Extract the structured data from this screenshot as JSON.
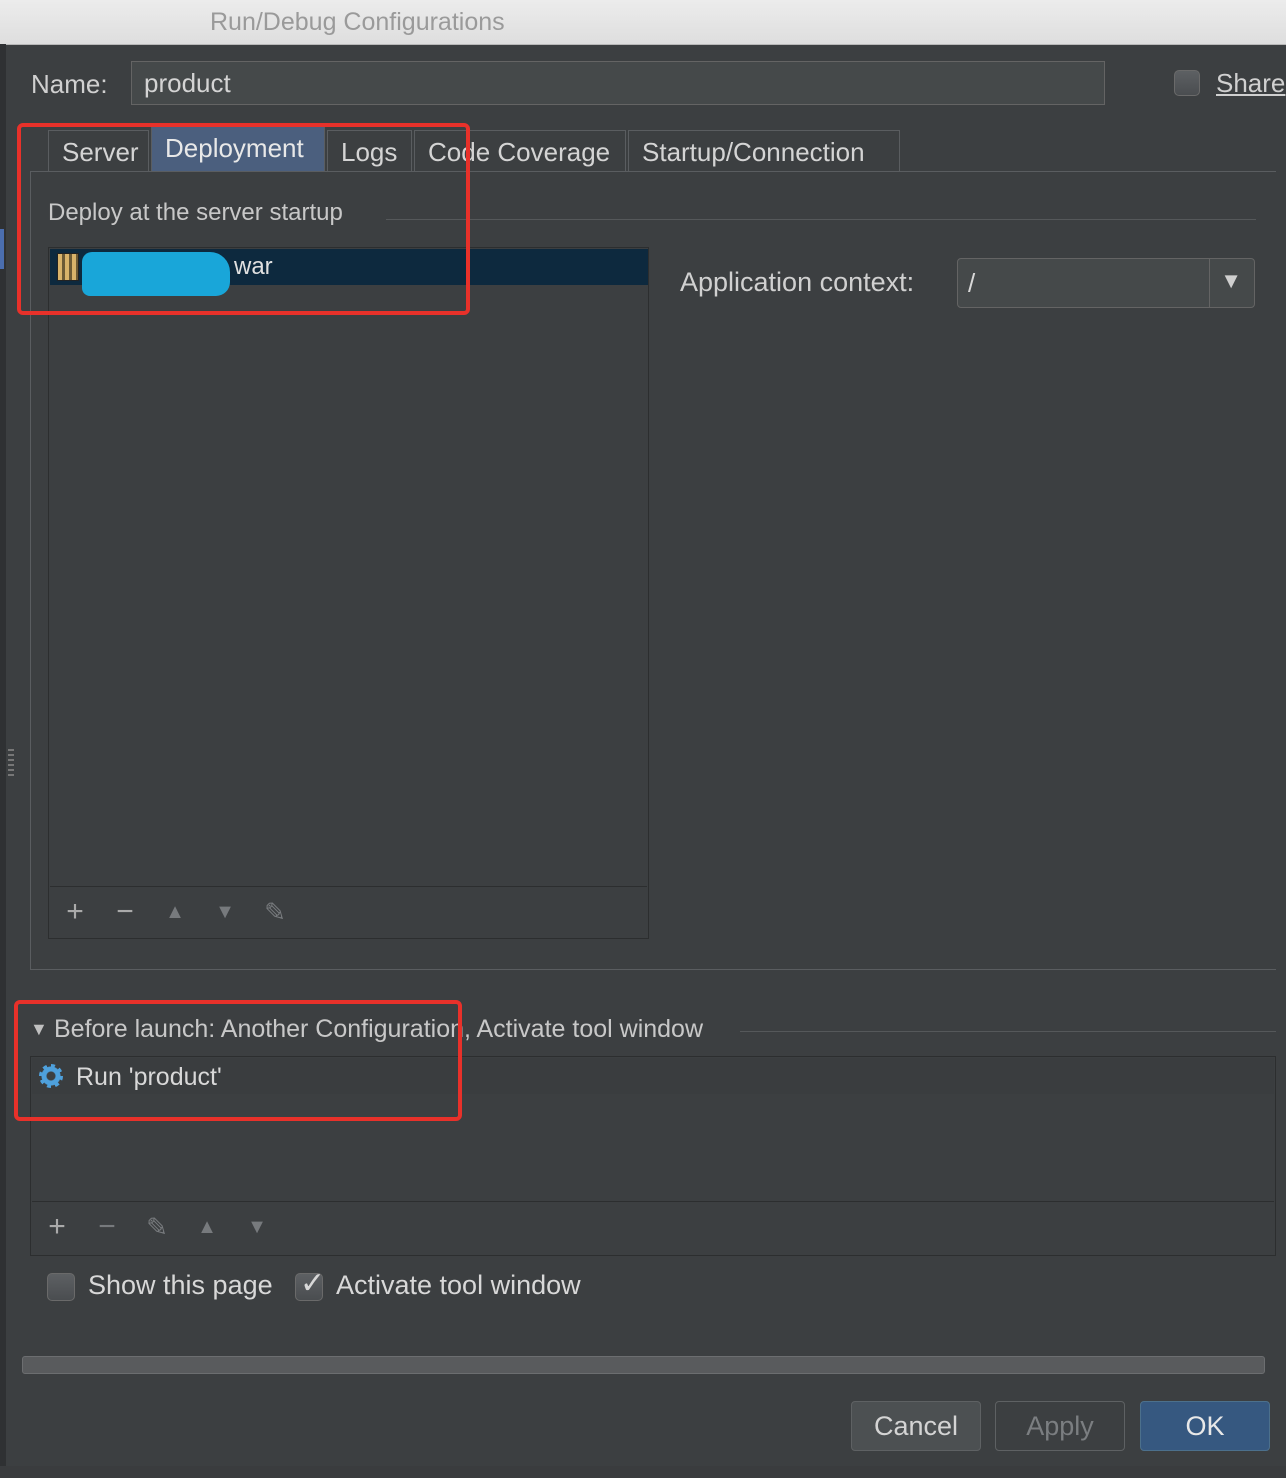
{
  "window": {
    "title": "Run/Debug Configurations"
  },
  "name_field": {
    "label": "Name:",
    "value": "product"
  },
  "share": {
    "label": "Share",
    "checked": false
  },
  "tabs": [
    "Server",
    "Deployment",
    "Logs",
    "Code Coverage",
    "Startup/Connection"
  ],
  "active_tab": "Deployment",
  "deployment": {
    "section_title": "Deploy at the server startup",
    "items": [
      {
        "label": "war"
      }
    ],
    "app_context_label": "Application context:",
    "app_context_value": "/"
  },
  "before_launch": {
    "title": "Before launch: Another Configuration, Activate tool window",
    "items": [
      {
        "label": "Run 'product'"
      }
    ]
  },
  "options": {
    "show_page_label": "Show this page",
    "show_page_checked": false,
    "activate_label": "Activate tool window",
    "activate_checked": true
  },
  "buttons": {
    "cancel": "Cancel",
    "apply": "Apply",
    "ok": "OK"
  },
  "colors": {
    "background": "#3c3f41",
    "selection": "#0d293e",
    "highlight_box": "#e8312a",
    "active_tab": "#4b5f7e",
    "ok_button": "#365880"
  }
}
